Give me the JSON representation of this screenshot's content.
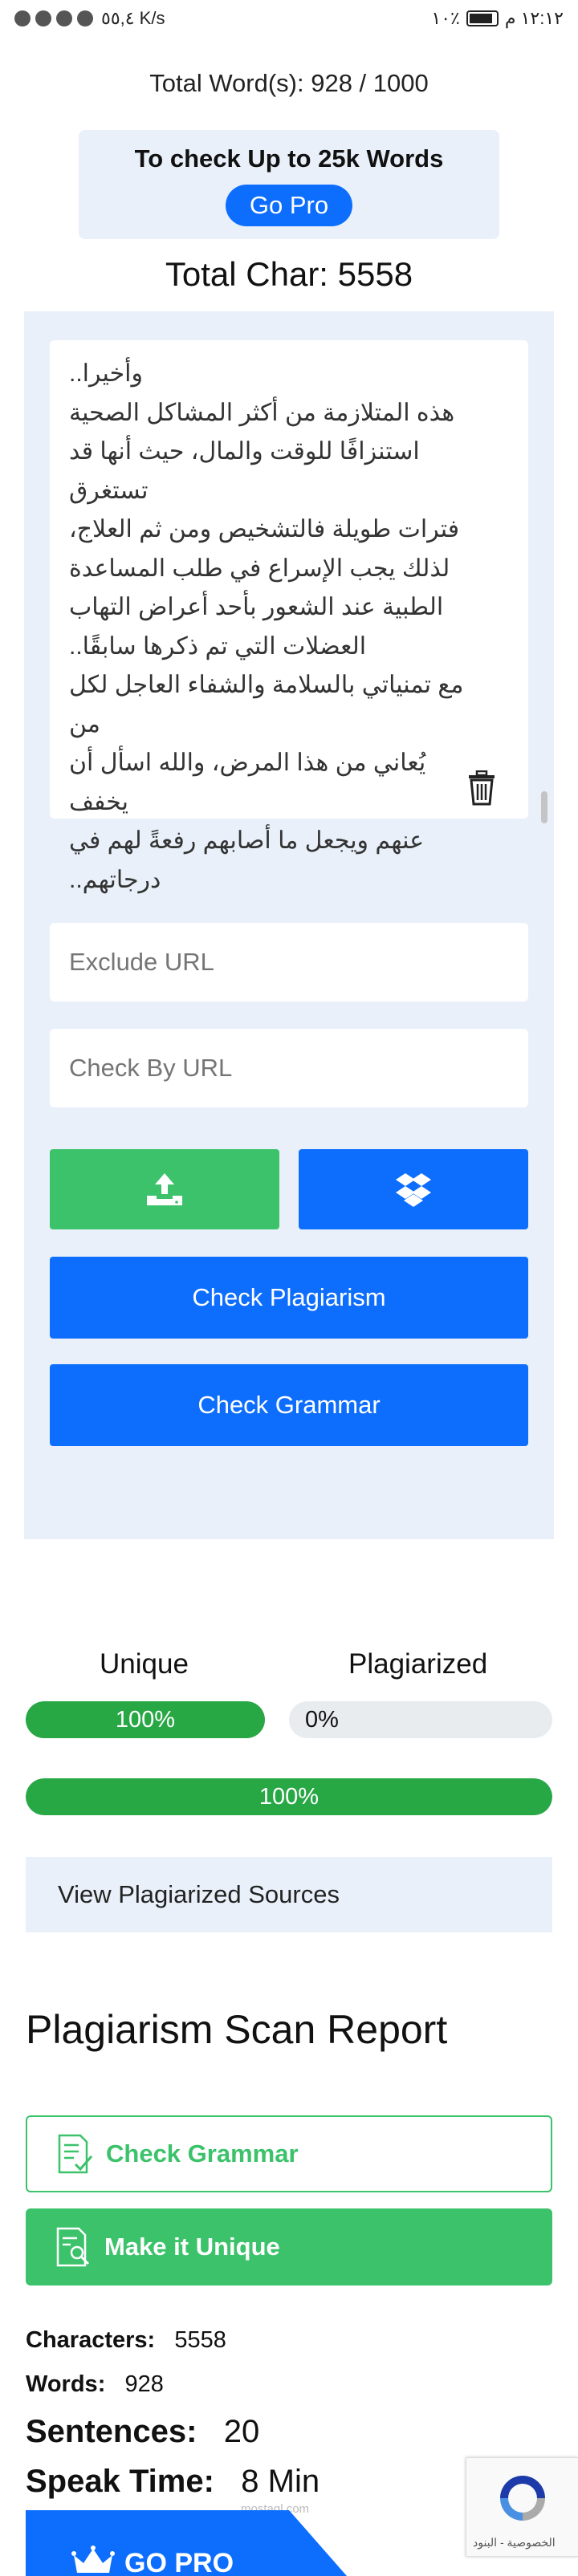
{
  "status_bar": {
    "time": "١٢:١٢ م",
    "battery": "٪١٠",
    "network": "٥٥,٤ K/s"
  },
  "header": {
    "word_count": "Total Word(s): 928 / 1000",
    "pro_title": "To check Up to 25k Words",
    "go_pro_label": "Go Pro",
    "total_char": "Total Char: 5558"
  },
  "editor": {
    "text": "وأخيرا..\nهذه المتلازمة من أكثر المشاكل الصحية\nاستنزافًا للوقت والمال، حيث أنها قد تستغرق\nفترات طويلة فالتشخيص ومن ثم العلاج،\nلذلك يجب الإسراع في طلب المساعدة\nالطبية عند الشعور بأحد أعراض التهاب\nالعضلات التي تم ذكرها سابقًا..\nمع تمنياتي بالسلامة والشفاء العاجل لكل من\nيُعاني من هذا المرض، والله اسأل أن يخفف\nعنهم ويجعل ما أصابهم رفعةً لهم في\nدرجاتهم..",
    "exclude_url_placeholder": "Exclude URL",
    "check_by_url_placeholder": "Check By URL",
    "check_plagiarism_label": "Check Plagiarism",
    "check_grammar_label": "Check Grammar"
  },
  "results": {
    "unique_label": "Unique",
    "plagiarized_label": "Plagiarized",
    "unique_value": "100%",
    "unique_fraction": 1.0,
    "plagiarized_value": "0%",
    "overall_value": "100%",
    "overall_fraction": 1.0,
    "view_sources_label": "View Plagiarized Sources"
  },
  "report": {
    "title": "Plagiarism Scan Report",
    "check_grammar_label": "Check Grammar",
    "make_unique_label": "Make it Unique",
    "characters_label": "Characters:",
    "characters_value": "5558",
    "words_label": "Words:",
    "words_value": "928",
    "sentences_label": "Sentences:",
    "sentences_value": "20",
    "speak_time_label": "Speak Time:",
    "speak_time_value": "8 Min"
  },
  "promo": {
    "label": "GO PRO"
  },
  "recaptcha": {
    "footer": "الخصوصية - البنود"
  },
  "watermark": "mostaql.com",
  "colors": {
    "primary": "#0d6efd",
    "success": "#3cc26a",
    "bar_green": "#28a745",
    "panel_bg": "#e9f0fa"
  }
}
